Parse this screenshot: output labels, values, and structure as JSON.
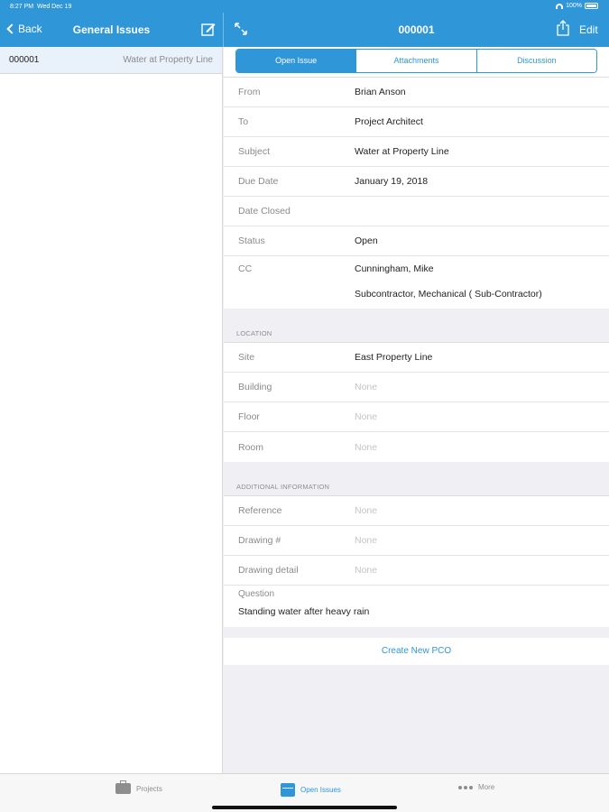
{
  "status_bar": {
    "time": "8:27 PM",
    "date": "Wed Dec 19",
    "battery": "100%"
  },
  "nav": {
    "back_label": "Back",
    "left_title": "General Issues",
    "right_title": "000001",
    "edit_label": "Edit"
  },
  "issues_list": [
    {
      "id": "000001",
      "subject": "Water at Property Line"
    }
  ],
  "segments": [
    {
      "label": "Open Issue",
      "active": true
    },
    {
      "label": "Attachments",
      "active": false
    },
    {
      "label": "Discussion",
      "active": false
    }
  ],
  "details": {
    "from": {
      "label": "From",
      "value": "Brian Anson"
    },
    "to": {
      "label": "To",
      "value": "Project Architect"
    },
    "subject": {
      "label": "Subject",
      "value": "Water at Property Line"
    },
    "due_date": {
      "label": "Due Date",
      "value": "January 19, 2018"
    },
    "date_closed": {
      "label": "Date Closed",
      "value": ""
    },
    "status": {
      "label": "Status",
      "value": "Open"
    },
    "cc": {
      "label": "CC",
      "values": [
        "Cunningham, Mike",
        "Subcontractor, Mechanical ( Sub-Contractor)"
      ]
    }
  },
  "location": {
    "header": "LOCATION",
    "site": {
      "label": "Site",
      "value": "East Property Line"
    },
    "building": {
      "label": "Building",
      "value": "None"
    },
    "floor": {
      "label": "Floor",
      "value": "None"
    },
    "room": {
      "label": "Room",
      "value": "None"
    }
  },
  "additional": {
    "header": "ADDITIONAL INFORMATION",
    "reference": {
      "label": "Reference",
      "value": "None"
    },
    "drawing_no": {
      "label": "Drawing #",
      "value": "None"
    },
    "drawing_detail": {
      "label": "Drawing detail",
      "value": "None"
    },
    "question": {
      "label": "Question",
      "value": "Standing water after heavy rain"
    }
  },
  "actions": {
    "create_pco": "Create New PCO"
  },
  "tabs": [
    {
      "label": "Projects",
      "icon": "briefcase-icon",
      "active": false
    },
    {
      "label": "Open Issues",
      "icon": "calendar-icon",
      "active": true
    },
    {
      "label": "More",
      "icon": "more-dots-icon",
      "active": false
    }
  ],
  "colors": {
    "accent": "#2f96d8",
    "nav_bg": "#2f96d8",
    "background": "#efeff4"
  }
}
